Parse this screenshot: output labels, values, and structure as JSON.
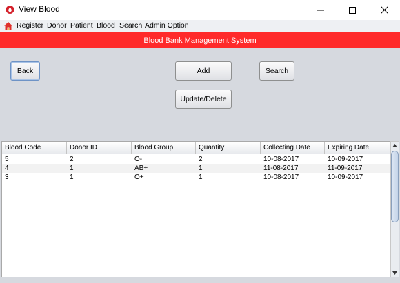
{
  "window": {
    "title": "View Blood",
    "icon": "blood-drop-icon",
    "controls": [
      "minimize-icon",
      "maximize-icon",
      "close-icon"
    ]
  },
  "menu": {
    "icon": "home-icon",
    "items": [
      "Register",
      "Donor",
      "Patient",
      "Blood",
      "Search",
      "Admin Option"
    ]
  },
  "banner": {
    "text": "Blood Bank Management System",
    "color": "#ff2a2a"
  },
  "buttons": {
    "back": "Back",
    "add": "Add",
    "search": "Search",
    "update_delete": "Update/Delete"
  },
  "table": {
    "columns": [
      "Blood Code",
      "Donor ID",
      "Blood Group",
      "Quantity",
      "Collecting Date",
      "Expiring Date"
    ],
    "rows": [
      [
        "5",
        "2",
        "O-",
        "2",
        "10-08-2017",
        "10-09-2017"
      ],
      [
        "4",
        "1",
        "AB+",
        "1",
        "11-08-2017",
        "11-09-2017"
      ],
      [
        "3",
        "1",
        "O+",
        "1",
        "10-08-2017",
        "10-09-2017"
      ]
    ]
  }
}
